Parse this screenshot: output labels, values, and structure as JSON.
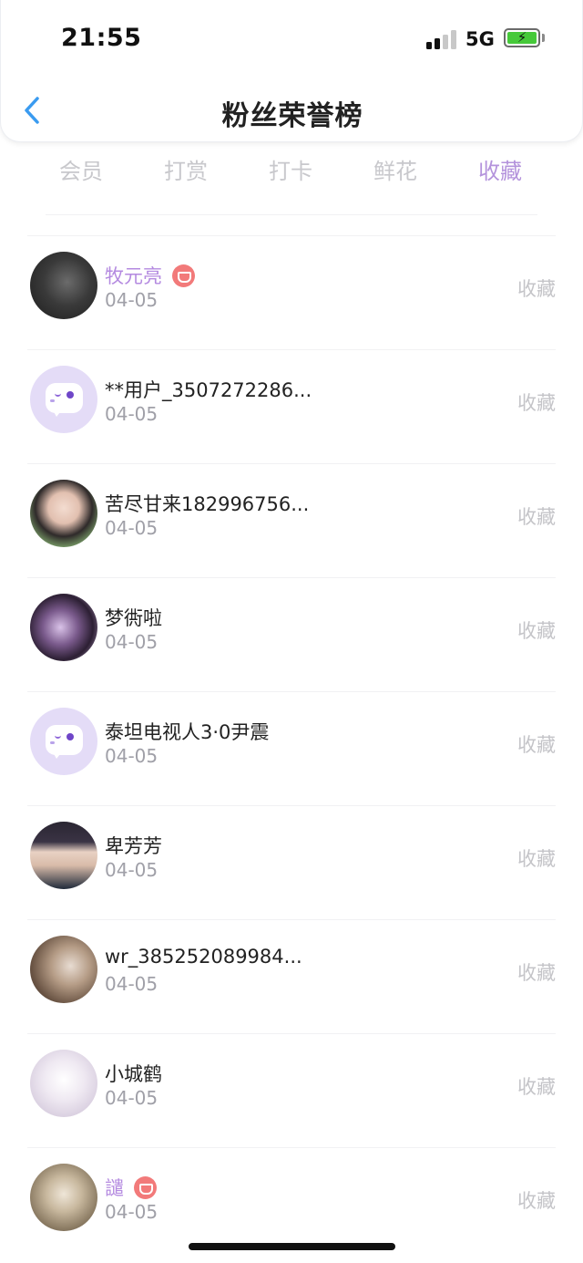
{
  "status_bar": {
    "time": "21:55",
    "network": "5G",
    "battery_level": 1.0,
    "battery_icon": "battery-charging-icon",
    "signal_icon": "cellular-signal-icon",
    "battery_color": "#46c93a"
  },
  "nav": {
    "back_icon": "chevron-left-icon",
    "title": "粉丝荣誉榜",
    "accent_color": "#3a9bf0"
  },
  "tabs": {
    "active_color": "#b493dc",
    "items": [
      {
        "label": "会员",
        "active": false
      },
      {
        "label": "打赏",
        "active": false
      },
      {
        "label": "打卡",
        "active": false
      },
      {
        "label": "鲜花",
        "active": false
      },
      {
        "label": "收藏",
        "active": true
      }
    ]
  },
  "list": {
    "items": [
      {
        "name": "牧元亮",
        "date": "04-05",
        "action": "收藏",
        "vip": true,
        "avatar": "photo"
      },
      {
        "name": "**用户_3507272286...",
        "date": "04-05",
        "action": "收藏",
        "vip": false,
        "avatar": "default"
      },
      {
        "name": "苦尽甘来182996756...",
        "date": "04-05",
        "action": "收藏",
        "vip": false,
        "avatar": "photo"
      },
      {
        "name": "梦衖啦",
        "date": "04-05",
        "action": "收藏",
        "vip": false,
        "avatar": "photo"
      },
      {
        "name": "泰坦电视人3·0尹震",
        "date": "04-05",
        "action": "收藏",
        "vip": false,
        "avatar": "default"
      },
      {
        "name": "卑芳芳",
        "date": "04-05",
        "action": "收藏",
        "vip": false,
        "avatar": "photo"
      },
      {
        "name": "wr_385252089984...",
        "date": "04-05",
        "action": "收藏",
        "vip": false,
        "avatar": "photo"
      },
      {
        "name": "小城鹤",
        "date": "04-05",
        "action": "收藏",
        "vip": false,
        "avatar": "photo"
      },
      {
        "name": "譴",
        "date": "04-05",
        "action": "收藏",
        "vip": true,
        "avatar": "photo"
      }
    ],
    "vip_badge_icon": "diamond-badge-icon",
    "vip_color": "#b48ae0"
  }
}
